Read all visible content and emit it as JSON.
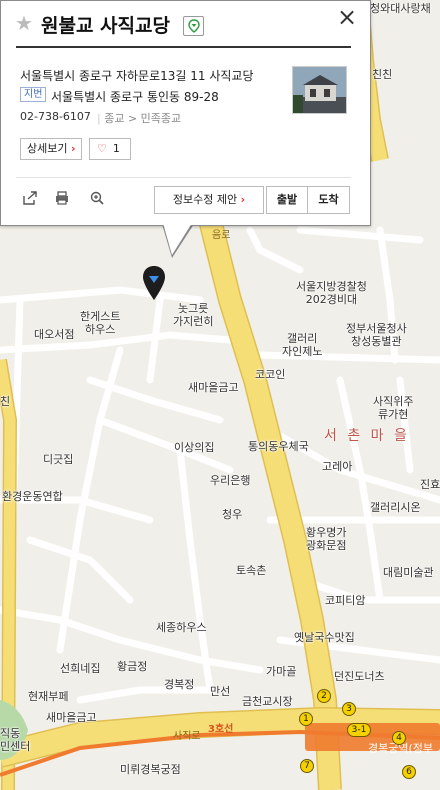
{
  "colors": {
    "map_bg": "#f1efe9",
    "block": "#ffffff",
    "major_road": "#f6de76",
    "major_road_edge": "#e0bf52",
    "subway": "#f07b2f",
    "district": "#c0564b"
  },
  "popup": {
    "title": "원불교 사직교당",
    "category_icon": "pin-icon",
    "close_glyph": "×",
    "address_road": "서울특별시 종로구 자하문로13길 11 사직교당",
    "jibun_tag": "지번",
    "address_jibun": "서울특별시 종로구 통인동 89-28",
    "phone": "02-738-6107",
    "category": "종교 > 민족종교",
    "detail_label": "상세보기",
    "like_count": "1",
    "edit_label": "정보수정 제안",
    "from_label": "출발",
    "to_label": "도착"
  },
  "labels": {
    "chungwadae": "청와대사랑채",
    "chin": "친친",
    "police": "서울지방경찰청\n202경비대",
    "govt": "정부서울청사\n창성동별관",
    "gallery_jain": "갤러리\n자인제노",
    "sajik": "사직위주\n류가현",
    "guesthouse": "한게스트\n하우스",
    "daeo": "대오서점",
    "nutgut": "놋그릇\n가지런히",
    "cocoin": "코코인",
    "saemaeul1": "새마을금고",
    "chin2": "친",
    "isangui": "이상의집",
    "tongui": "통의동우체국",
    "digeut": "디긋집",
    "woori": "우리은행",
    "goreya": "고레아",
    "jinhyo": "진효",
    "environment": "환경운동연합",
    "cheongwoo": "청우",
    "gallery_sion": "갤러리시온",
    "hwangso": "황우명가\n광화문점",
    "tosokchon": "토속촌",
    "daerim": "대림미술관",
    "kopitiam": "코피티암",
    "sejong": "세종하우스",
    "yetnal": "옛날국수맛집",
    "seonhui": "선희네집",
    "hwangeum": "황금정",
    "gamagol": "가마골",
    "gyeongbokjeong": "경복정",
    "deonjin": "던진도너츠",
    "manseon": "만선",
    "geumcheon": "금천교시장",
    "hyeonje": "현재부페",
    "saemaeul2": "새마을금고",
    "mirugyeong": "미뤼경복궁점",
    "ijik": "직동\n민센터",
    "east_road": "음로",
    "road_sajik": "사직로",
    "line3": "3호선",
    "station": "경복궁역(정부",
    "dist": "서 촌 마 을"
  },
  "exits": [
    "1",
    "2",
    "3",
    "3-1",
    "4",
    "6",
    "7"
  ]
}
